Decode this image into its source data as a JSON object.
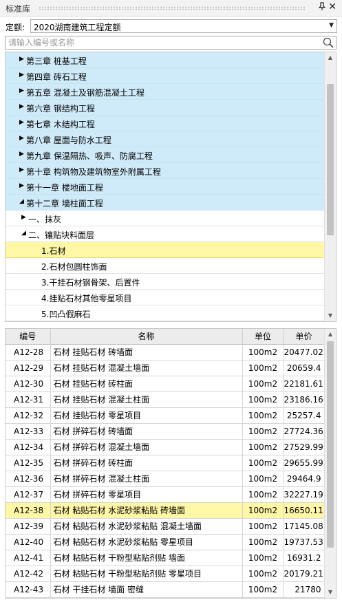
{
  "panel": {
    "title": "标准库",
    "pin_icon": "pin-icon",
    "close_glyph": "✕"
  },
  "quota": {
    "label": "定额:",
    "selected": "2020湖南建筑工程定额"
  },
  "search": {
    "placeholder": "请输入编号或名称",
    "value": ""
  },
  "tree": {
    "nodes": [
      {
        "label": "第三章 桩基工程",
        "level": 0,
        "expanded": false,
        "style": "blue"
      },
      {
        "label": "第四章 砖石工程",
        "level": 0,
        "expanded": false,
        "style": "blue"
      },
      {
        "label": "第五章 混凝土及钢筋混凝土工程",
        "level": 0,
        "expanded": false,
        "style": "blue"
      },
      {
        "label": "第六章 钢结构工程",
        "level": 0,
        "expanded": false,
        "style": "blue"
      },
      {
        "label": "第七章 木结构工程",
        "level": 0,
        "expanded": false,
        "style": "blue"
      },
      {
        "label": "第八章 屋面与防水工程",
        "level": 0,
        "expanded": false,
        "style": "blue"
      },
      {
        "label": "第九章 保温隔热、吸声、防腐工程",
        "level": 0,
        "expanded": false,
        "style": "blue"
      },
      {
        "label": "第十章 构筑物及建筑物室外附属工程",
        "level": 0,
        "expanded": false,
        "style": "blue"
      },
      {
        "label": "第十一章 楼地面工程",
        "level": 0,
        "expanded": false,
        "style": "blue"
      },
      {
        "label": "第十二章 墙柱面工程",
        "level": 0,
        "expanded": true,
        "style": "blue"
      },
      {
        "label": "一、抹灰",
        "level": 1,
        "expanded": false,
        "style": "white"
      },
      {
        "label": "二、镶贴块料面层",
        "level": 1,
        "expanded": true,
        "style": "white"
      },
      {
        "label": "1.石材",
        "level": 2,
        "leaf": true,
        "style": "sel"
      },
      {
        "label": "2.石材包圆柱饰面",
        "level": 2,
        "leaf": true,
        "style": "white"
      },
      {
        "label": "3.干挂石材钢骨架、后置件",
        "level": 2,
        "leaf": true,
        "style": "white"
      },
      {
        "label": "4.挂贴石材其他零星项目",
        "level": 2,
        "leaf": true,
        "style": "white"
      },
      {
        "label": "5.凹凸假麻石",
        "level": 2,
        "leaf": true,
        "style": "white"
      }
    ]
  },
  "table": {
    "columns": [
      "编号",
      "名称",
      "单位",
      "单价"
    ],
    "rows": [
      {
        "code": "A12-28",
        "name": "石材 挂贴石材 砖墙面",
        "unit": "100m2",
        "price": "20477.02"
      },
      {
        "code": "A12-29",
        "name": "石材 挂贴石材 混凝土墙面",
        "unit": "100m2",
        "price": "20659.4"
      },
      {
        "code": "A12-30",
        "name": "石材 挂贴石材 砖柱面",
        "unit": "100m2",
        "price": "22181.61"
      },
      {
        "code": "A12-31",
        "name": "石材 挂贴石材 混凝土柱面",
        "unit": "100m2",
        "price": "23186.16"
      },
      {
        "code": "A12-32",
        "name": "石材 挂贴石材 零星项目",
        "unit": "100m2",
        "price": "25257.4"
      },
      {
        "code": "A12-33",
        "name": "石材 拼碎石材 砖墙面",
        "unit": "100m2",
        "price": "27724.36"
      },
      {
        "code": "A12-34",
        "name": "石材 拼碎石材 混凝土墙面",
        "unit": "100m2",
        "price": "27529.99"
      },
      {
        "code": "A12-35",
        "name": "石材 拼碎石材 砖柱面",
        "unit": "100m2",
        "price": "29655.99"
      },
      {
        "code": "A12-36",
        "name": "石材 拼碎石材 混凝土柱面",
        "unit": "100m2",
        "price": "29464.9"
      },
      {
        "code": "A12-37",
        "name": "石材 拼碎石材 零星项目",
        "unit": "100m2",
        "price": "32227.19"
      },
      {
        "code": "A12-38",
        "name": "石材 粘贴石材 水泥砂浆粘贴 砖墙面",
        "unit": "100m2",
        "price": "16650.11",
        "selected": true
      },
      {
        "code": "A12-39",
        "name": "石材 粘贴石材 水泥砂浆粘贴 混凝土墙面",
        "unit": "100m2",
        "price": "17145.08"
      },
      {
        "code": "A12-40",
        "name": "石材 粘贴石材 水泥砂浆粘贴 零星项目",
        "unit": "100m2",
        "price": "19737.53"
      },
      {
        "code": "A12-41",
        "name": "石材 粘贴石材 干粉型粘贴剂贴 墙面",
        "unit": "100m2",
        "price": "16931.2"
      },
      {
        "code": "A12-42",
        "name": "石材 粘贴石材 干粉型粘贴剂贴 零星项目",
        "unit": "100m2",
        "price": "20179.21"
      },
      {
        "code": "A12-43",
        "name": "石材 干挂石材 墙面 密缝",
        "unit": "100m2",
        "price": "21780"
      }
    ]
  },
  "colors": {
    "tree_chapter_bg": "#cfeaf8",
    "selection_bg": "#fef7a6",
    "header_bg": "#ececec"
  }
}
